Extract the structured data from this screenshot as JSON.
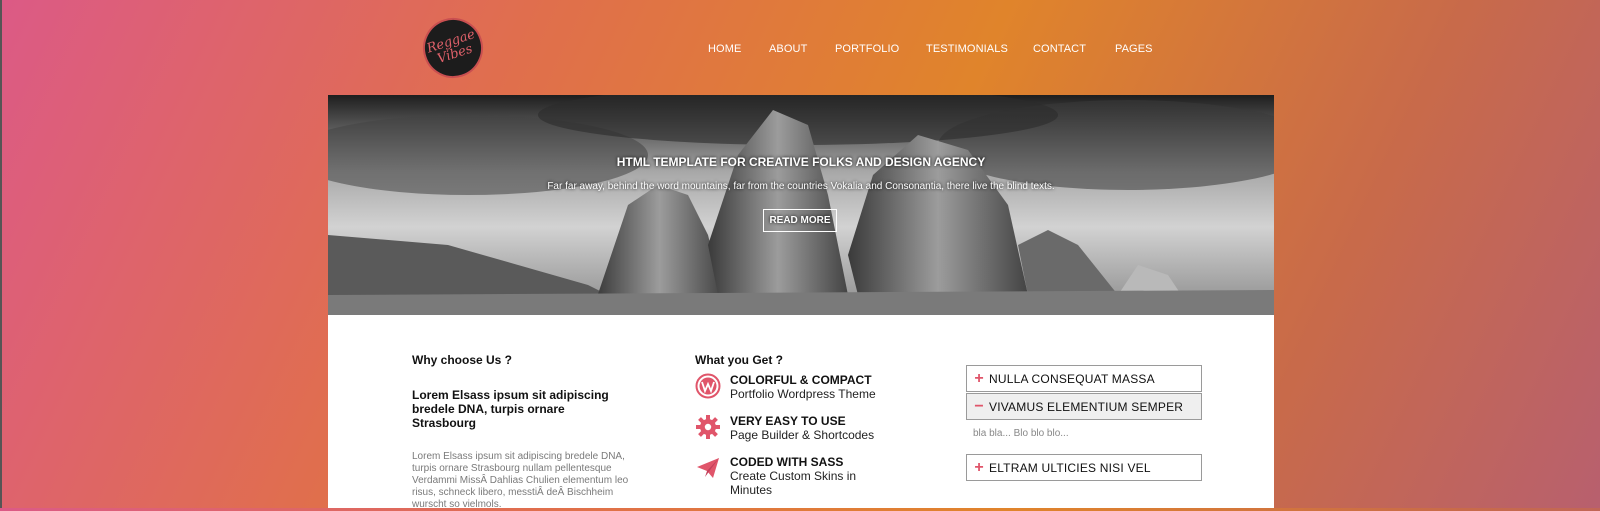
{
  "logo": {
    "line1": "Reggae",
    "line2": "Vibes"
  },
  "nav": {
    "items": [
      "HOME",
      "ABOUT",
      "PORTFOLIO",
      "TESTIMONIALS",
      "CONTACT",
      "PAGES"
    ]
  },
  "hero": {
    "title": "HTML TEMPLATE FOR CREATIVE FOLKS AND DESIGN AGENCY",
    "subtitle": "Far far away, behind the word mountains, far from the countries Vokalia and Consonantia, there live the blind texts.",
    "button": "READ MORE"
  },
  "why": {
    "heading": "Why choose Us ?",
    "subheading": "Lorem Elsass ipsum sit adipiscing bredele DNA, turpis ornare Strasbourg",
    "body": "Lorem Elsass ipsum sit adipiscing bredele DNA, turpis ornare Strasbourg nullam pellentesque Verdammi MissÂ Dahlias Chulien elementum leo risus, schneck libero, messtiÂ deÂ Bischheim wurscht so vielmols."
  },
  "get": {
    "heading": "What you Get ?",
    "features": [
      {
        "icon": "wordpress-icon",
        "title": "COLORFUL & COMPACT",
        "sub": "Portfolio Wordpress Theme"
      },
      {
        "icon": "gear-icon",
        "title": "VERY EASY TO USE",
        "sub": "Page Builder & Shortcodes"
      },
      {
        "icon": "paper-plane-icon",
        "title": "CODED WITH SASS",
        "sub": "Create Custom Skins in Minutes"
      }
    ]
  },
  "accordion": {
    "items": [
      {
        "sign": "+",
        "label": "NULLA CONSEQUAT MASSA"
      },
      {
        "sign": "−",
        "label": "VIVAMUS ELEMENTIUM SEMPER"
      },
      {
        "sign": "+",
        "label": "ELTRAM ULTICIES NISI VEL"
      }
    ],
    "open_body": "bla bla... Blo blo blo..."
  },
  "colors": {
    "accent": "#e0556a",
    "bg_from": "#dc5a86",
    "bg_to": "#e0842b"
  }
}
